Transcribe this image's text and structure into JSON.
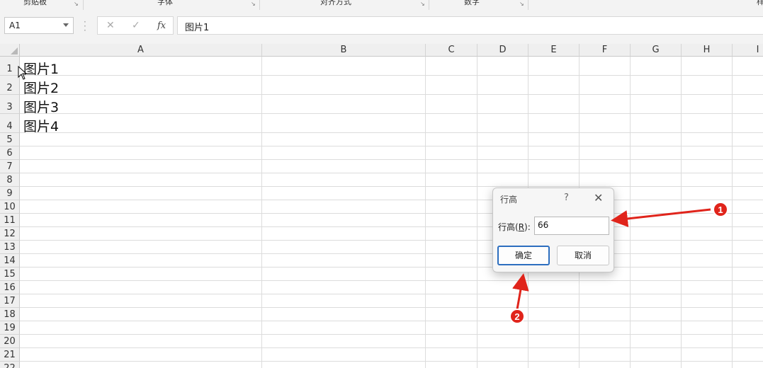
{
  "ribbon": {
    "groups": [
      "剪贴板",
      "字体",
      "对齐方式",
      "数字"
    ],
    "partial_right": "样"
  },
  "formula_bar": {
    "name_box": "A1",
    "cancel_icon": "✕",
    "enter_icon": "✓",
    "fx_label": "fx",
    "formula": "图片1"
  },
  "columns": [
    "A",
    "B",
    "C",
    "D",
    "E",
    "F",
    "G",
    "H",
    "I"
  ],
  "rows": [
    "1",
    "2",
    "3",
    "4",
    "5",
    "6",
    "7",
    "8",
    "9",
    "10",
    "11",
    "12",
    "13",
    "14",
    "15",
    "16",
    "17",
    "18",
    "19",
    "20",
    "21",
    "22"
  ],
  "cells": {
    "A1": "图片1",
    "A2": "图片2",
    "A3": "图片3",
    "A4": "图片4"
  },
  "dialog": {
    "title": "行高",
    "help": "?",
    "close": "✕",
    "field_label_prefix": "行高(",
    "field_label_key": "R",
    "field_label_suffix": "):",
    "value": "66",
    "ok_label": "确定",
    "cancel_label": "取消"
  },
  "annotations": {
    "marker_1": "1",
    "marker_2": "2",
    "color": "#e0241b"
  }
}
